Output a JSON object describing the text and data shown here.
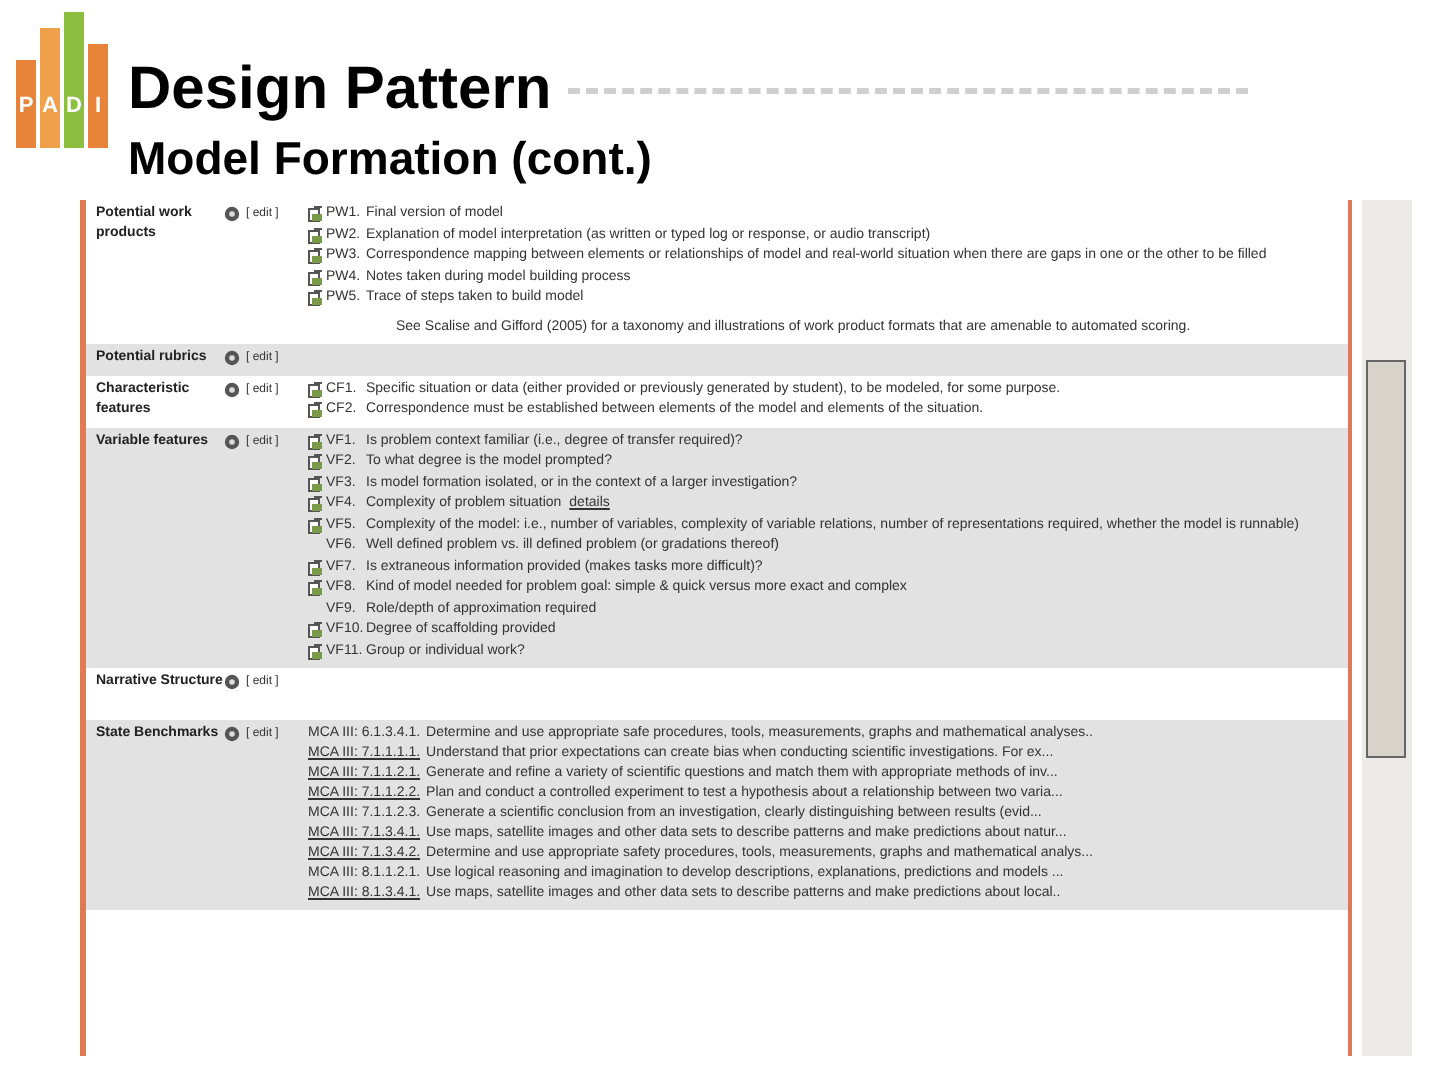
{
  "logo": {
    "letters": [
      "P",
      "A",
      "D",
      "I"
    ]
  },
  "title": "Design Pattern",
  "subtitle": "Model Formation (cont.)",
  "rows": [
    {
      "label": "Potential work products",
      "edit": "[ edit ]",
      "kind": "list",
      "items": [
        {
          "code": "PW1.",
          "text": "Final version of model",
          "icon": true
        },
        {
          "code": "PW2.",
          "text": "Explanation of model interpretation (as written or typed log or response, or audio transcript)",
          "icon": true
        },
        {
          "code": "PW3.",
          "text": "Correspondence mapping between elements or relationships of model and real-world situation when there are gaps in one or the other to be filled",
          "icon": true
        },
        {
          "code": "PW4.",
          "text": "Notes taken during model building process",
          "icon": true
        },
        {
          "code": "PW5.",
          "text": "Trace of steps taken to build model",
          "icon": true
        }
      ],
      "note": "See Scalise and Gifford (2005) for a taxonomy and illustrations of work product formats that are amenable to automated scoring."
    },
    {
      "label": "Potential rubrics",
      "edit": "[ edit ]",
      "kind": "empty"
    },
    {
      "label": "Characteristic features",
      "edit": "[ edit ]",
      "kind": "list",
      "items": [
        {
          "code": "CF1.",
          "text": "Specific situation or data (either provided or previously generated by student), to be modeled, for some purpose.",
          "icon": true
        },
        {
          "code": "CF2.",
          "text": "Correspondence must be established between elements of the model and elements of the situation.",
          "icon": true
        }
      ]
    },
    {
      "label": "Variable features",
      "edit": "[ edit ]",
      "kind": "list",
      "items": [
        {
          "code": "VF1.",
          "text": "Is problem context familiar (i.e., degree of transfer required)?",
          "icon": true
        },
        {
          "code": "VF2.",
          "text": "To what degree is the model prompted?",
          "icon": true
        },
        {
          "code": "VF3.",
          "text": "Is model formation isolated, or in the context of a larger investigation?",
          "icon": true
        },
        {
          "code": "VF4.",
          "text": "Complexity of problem situation",
          "link": "details",
          "icon": true
        },
        {
          "code": "VF5.",
          "text": "Complexity of the model: i.e., number of variables, complexity of variable relations, number of representations required, whether the model is runnable)",
          "icon": true
        },
        {
          "code": "VF6.",
          "text": "Well defined problem vs. ill defined problem (or gradations thereof)",
          "icon": false
        },
        {
          "code": "VF7.",
          "text": "Is extraneous information provided (makes tasks more difficult)?",
          "icon": true
        },
        {
          "code": "VF8.",
          "text": "Kind of model needed for problem goal: simple & quick versus more exact and complex",
          "icon": true
        },
        {
          "code": "VF9.",
          "text": "Role/depth of approximation required",
          "icon": false
        },
        {
          "code": "VF10.",
          "text": "Degree of scaffolding provided",
          "icon": true
        },
        {
          "code": "VF11.",
          "text": "Group or individual work?",
          "icon": true
        }
      ]
    },
    {
      "label": "Narrative Structure",
      "edit": "[ edit ]",
      "kind": "empty"
    },
    {
      "label": "State Benchmarks",
      "edit": "[ edit ]",
      "kind": "benchmarks",
      "items": [
        {
          "code": "MCA III: 6.1.3.4.1.",
          "text": "Determine and use appropriate safe procedures, tools, measurements, graphs and mathematical analyses..",
          "linked": false
        },
        {
          "code": "MCA III: 7.1.1.1.1.",
          "text": "Understand that prior expectations can create bias when conducting scientific investigations. For ex...",
          "linked": true
        },
        {
          "code": "MCA III: 7.1.1.2.1.",
          "text": "Generate and refine a variety of scientific questions and match them with appropriate methods of inv...",
          "linked": true
        },
        {
          "code": "MCA III: 7.1.1.2.2.",
          "text": "Plan and conduct a controlled experiment to test a hypothesis about a relationship between two varia...",
          "linked": true
        },
        {
          "code": "MCA III: 7.1.1.2.3.",
          "text": "Generate a scientific conclusion from an investigation, clearly distinguishing between results (evid...",
          "linked": false
        },
        {
          "code": "MCA III: 7.1.3.4.1.",
          "text": "Use maps, satellite images and other data sets to describe patterns and make predictions about natur...",
          "linked": true
        },
        {
          "code": "MCA III: 7.1.3.4.2.",
          "text": "Determine and use appropriate safety procedures, tools, measurements, graphs and mathematical analys...",
          "linked": true
        },
        {
          "code": "MCA III: 8.1.1.2.1.",
          "text": "Use logical reasoning and imagination to develop descriptions, explanations, predictions and models ...",
          "linked": false
        },
        {
          "code": "MCA III: 8.1.3.4.1.",
          "text": "Use maps, satellite images and other data sets to describe patterns and make predictions about local..",
          "linked": true
        }
      ]
    }
  ]
}
